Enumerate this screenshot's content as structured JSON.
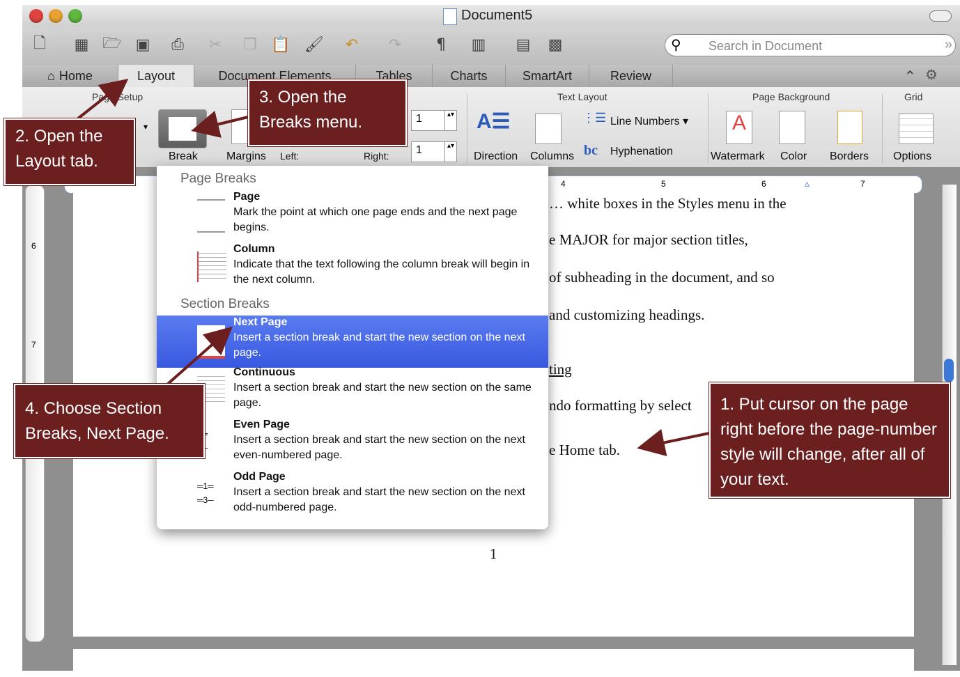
{
  "window": {
    "title": "Document5"
  },
  "toolbar": {
    "search_placeholder": "Search in Document"
  },
  "tabs": [
    "Home",
    "Layout",
    "Document Elements",
    "Tables",
    "Charts",
    "SmartArt",
    "Review"
  ],
  "ribbon": {
    "group_page_setup": "Page Setup",
    "group_text_layout": "Text Layout",
    "group_page_background": "Page Background",
    "group_grid": "Grid",
    "break_label": "Break",
    "margins_label": "Margins",
    "left_label": "Left:",
    "right_label": "Right:",
    "field1_value": "1",
    "field2_value": "1",
    "direction_label": "Direction",
    "columns_label": "Columns",
    "line_numbers_label": "Line Numbers",
    "hyphenation_label": "Hyphenation",
    "watermark_label": "Watermark",
    "color_label": "Color",
    "borders_label": "Borders",
    "options_label": "Options"
  },
  "ruler": {
    "marks": [
      "4",
      "5",
      "6",
      "7"
    ],
    "left_marks": [
      "6",
      "7"
    ]
  },
  "document": {
    "line1": "… white boxes in the Styles menu in the",
    "line2": "e MAJOR for major section titles,",
    "line3": "of subheading in the document, and so",
    "line4": "and customizing headings.",
    "heading": "ting",
    "line5": "ndo formatting by select",
    "line6": "e Home tab.",
    "page_number": "1"
  },
  "breaks_menu": {
    "page_breaks_header": "Page Breaks",
    "section_breaks_header": "Section Breaks",
    "items": [
      {
        "title": "Page",
        "desc": "Mark the point at which one page ends and the next page begins."
      },
      {
        "title": "Column",
        "desc": "Indicate that the text following the column break will begin in the next column."
      },
      {
        "title": "Next Page",
        "desc": "Insert a section break and start the new section on the next page."
      },
      {
        "title": "Continuous",
        "desc": "Insert a section break and start the new section on the same page."
      },
      {
        "title": "Even Page",
        "desc": "Insert a section break and start the new section on the next even-numbered page."
      },
      {
        "title": "Odd Page",
        "desc": "Insert a section break and start the new section on the next odd-numbered page."
      }
    ]
  },
  "callouts": {
    "c1": "1. Put cursor on the page right before the page-number style will change, after all of your text.",
    "c2": "2. Open the Layout tab.",
    "c3": "3. Open the Breaks menu.",
    "c4": "4. Choose Section Breaks, Next Page."
  },
  "colors": {
    "callout_bg": "#6b1f1f",
    "selection": "#3f5fe3"
  }
}
